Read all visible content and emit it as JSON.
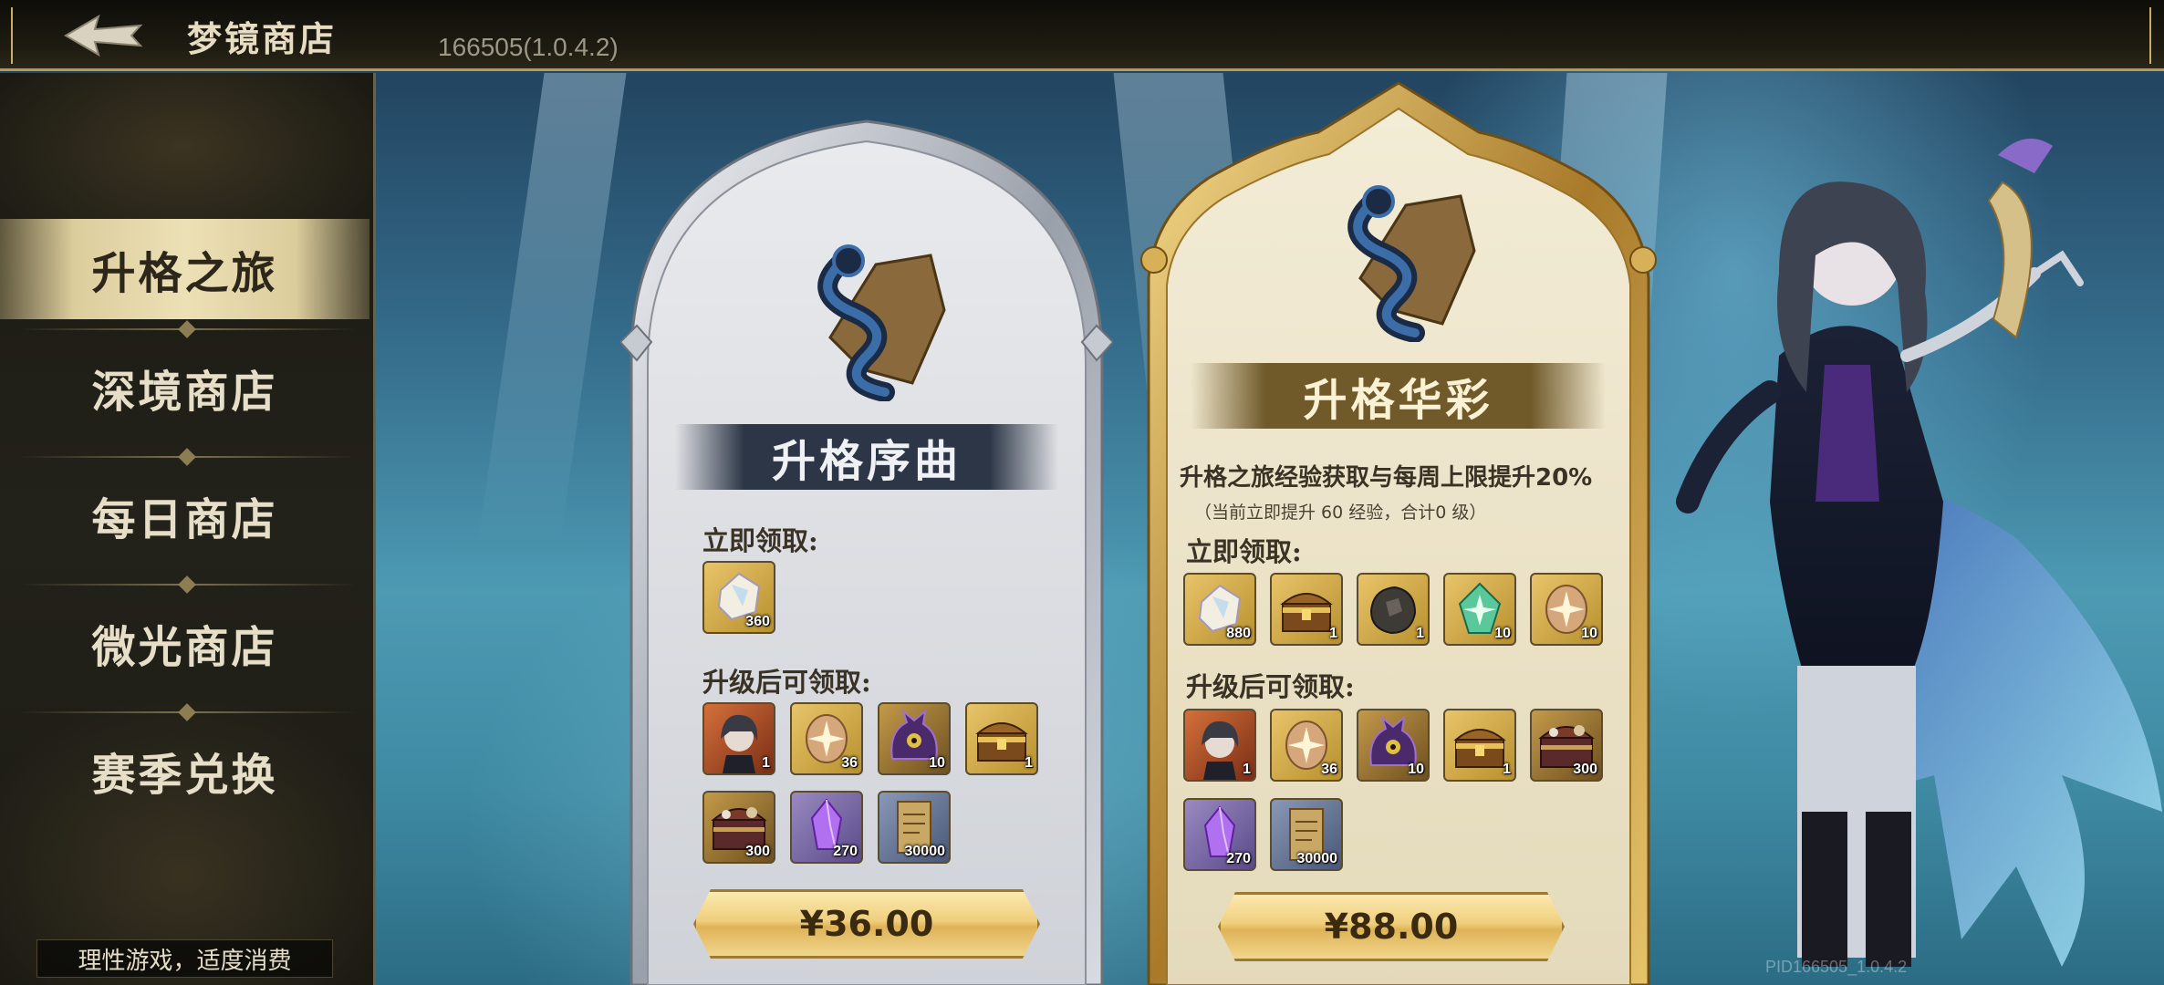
{
  "header": {
    "title": "梦镜商店",
    "version": "166505(1.0.4.2)"
  },
  "sidebar": {
    "items": [
      {
        "label": "升格之旅",
        "active": true
      },
      {
        "label": "深境商店",
        "active": false
      },
      {
        "label": "每日商店",
        "active": false
      },
      {
        "label": "微光商店",
        "active": false
      },
      {
        "label": "赛季兑换",
        "active": false
      }
    ],
    "disclaimer": "理性游戏，适度消费"
  },
  "cards": [
    {
      "name": "升格序曲",
      "immediate_label": "立即领取:",
      "immediate_items": [
        {
          "icon": "crystal-icon",
          "qty": "360"
        }
      ],
      "upgrade_label": "升级后可领取:",
      "upgrade_items": [
        {
          "icon": "character-portrait-icon",
          "qty": "1"
        },
        {
          "icon": "sparkle-stone-icon",
          "qty": "36"
        },
        {
          "icon": "purple-creature-icon",
          "qty": "10"
        },
        {
          "icon": "treasure-chest-icon",
          "qty": "1"
        },
        {
          "icon": "ornate-chest-icon",
          "qty": "300"
        },
        {
          "icon": "purple-crystal-icon",
          "qty": "270"
        },
        {
          "icon": "scroll-icon",
          "qty": "30000"
        }
      ],
      "price": "¥36.00"
    },
    {
      "name": "升格华彩",
      "description": "升格之旅经验获取与每周上限提升20%",
      "description_sub": "（当前立即提升 60 经验，合计0 级）",
      "immediate_label": "立即领取:",
      "immediate_items": [
        {
          "icon": "crystal-icon",
          "qty": "880"
        },
        {
          "icon": "treasure-chest-icon",
          "qty": "1"
        },
        {
          "icon": "dark-stone-icon",
          "qty": "1"
        },
        {
          "icon": "green-gem-icon",
          "qty": "10"
        },
        {
          "icon": "sparkle-stone-icon",
          "qty": "10"
        }
      ],
      "upgrade_label": "升级后可领取:",
      "upgrade_items": [
        {
          "icon": "character-portrait-icon",
          "qty": "1"
        },
        {
          "icon": "sparkle-stone-icon",
          "qty": "36"
        },
        {
          "icon": "purple-creature-icon",
          "qty": "10"
        },
        {
          "icon": "treasure-chest-icon",
          "qty": "1"
        },
        {
          "icon": "ornate-chest-icon",
          "qty": "300"
        },
        {
          "icon": "purple-crystal-icon",
          "qty": "270"
        },
        {
          "icon": "scroll-icon",
          "qty": "30000"
        }
      ],
      "price": "¥88.00"
    }
  ],
  "footer": {
    "pid": "PID166505_1.0.4.2"
  },
  "colors": {
    "gold": "#c9ad63",
    "card_silver": "#d9dbe0",
    "card_gold": "#efe6cc"
  }
}
